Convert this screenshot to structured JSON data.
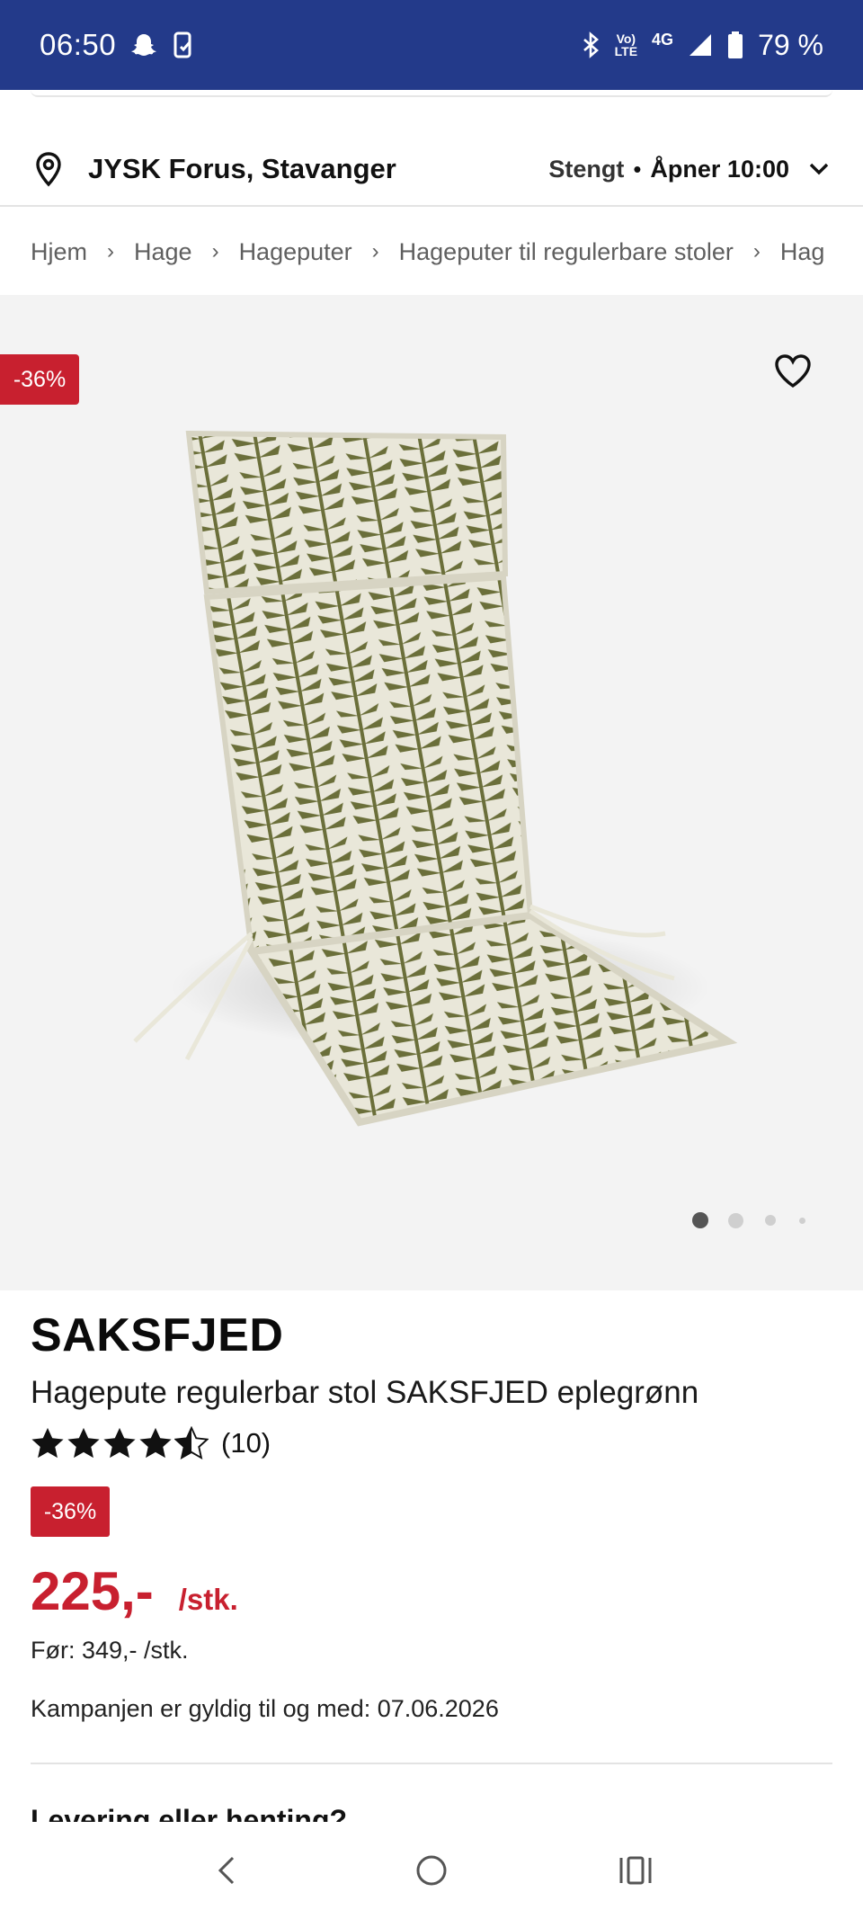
{
  "status_bar": {
    "time": "06:50",
    "volte_label": "Vo)\nLTE",
    "network": "4G",
    "battery": "79 %"
  },
  "store": {
    "name": "JYSK Forus, Stavanger",
    "status": "Stengt",
    "separator": "•",
    "opens": "Åpner 10:00"
  },
  "breadcrumb": [
    "Hjem",
    "Hage",
    "Hageputer",
    "Hageputer til regulerbare stoler",
    "Hag"
  ],
  "gallery": {
    "discount_badge": "-36%",
    "active_image_index": 0,
    "image_count": 4
  },
  "product": {
    "brand": "SAKSFJED",
    "title": "Hagepute regulerbar stol SAKSFJED eplegrønn",
    "rating": 4.5,
    "review_count": "(10)",
    "discount_badge": "-36%",
    "price": "225,-",
    "unit": "/stk.",
    "before_price": "Før: 349,- /stk.",
    "campaign": "Kampanjen er gyldig til og med: 07.06.2026"
  },
  "delivery_heading": "Levering eller henting?",
  "colors": {
    "status_bar": "#233a8a",
    "accent_red": "#c8202f",
    "gallery_bg": "#f3f3f3"
  },
  "icons": {
    "location": "location-pin-icon",
    "chevron": "chevron-down-icon",
    "favorite": "heart-icon",
    "star": "star-icon"
  }
}
